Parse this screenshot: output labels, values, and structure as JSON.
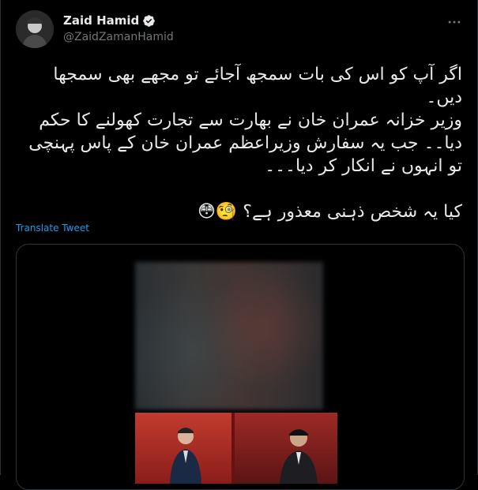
{
  "tweet": {
    "author_name": "Zaid Hamid",
    "author_handle": "@ZaidZamanHamid",
    "text": "اگر آپ کو اس کی بات سمجھ آجائے تو مجھے بھی سمجھا دیں۔\nوزیر خزانہ عمران خان نے بھارت سے تجارت کھولنے کا حکم دیا۔۔ جب یہ سفارش وزیراعظم عمران خان کے پاس پہنچی تو انہوں نے انکار کر دیا۔۔۔\n\nکیا یہ شخص ذہنی معذور ہے؟ 🧐😳",
    "translate_label": "Translate Tweet"
  },
  "icons": {
    "verified": "verified-badge-icon",
    "more": "more-options-icon"
  },
  "colors": {
    "background": "#000000",
    "link": "#1d9bf0",
    "secondary_text": "#71767b"
  }
}
